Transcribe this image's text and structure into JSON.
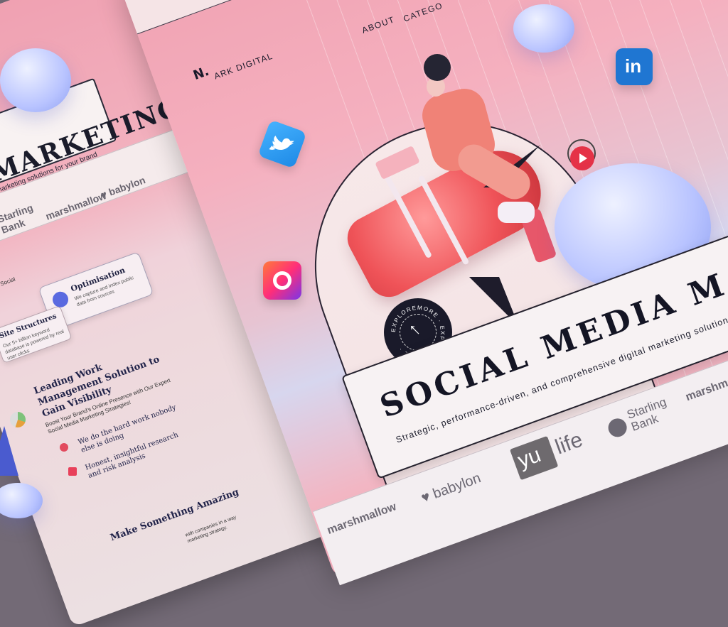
{
  "main": {
    "logo": {
      "mark": "N.",
      "text": "ARK DIGITAL"
    },
    "nav": {
      "about": "ABOUT",
      "categories": "CATEGO"
    },
    "headline": "SOCIAL MEDIA MARKETING",
    "subline": "Strategic, performance-driven, and comprehensive digital marketing solutions for your brand",
    "badge": {
      "text": "EXPLOREMORE · EXPLOREMORE ·"
    },
    "logos": {
      "marshmallow": "marshmallow",
      "babylon": "babylon",
      "yu": "yu",
      "life": "life",
      "starling": "Starling",
      "bank": "Bank",
      "marshmallow2": "marshmallow"
    }
  },
  "left": {
    "title": "MARKETING",
    "sub": "marketing solutions for your brand",
    "logos": {
      "babylon": "babylon",
      "marshmallow": "marshmallow",
      "starling": "Starling",
      "bank": "Bank"
    },
    "social": "Social",
    "cards": {
      "optimisation": {
        "title": "Optimisation",
        "desc": "We capture and index public data from sources"
      },
      "site": {
        "title": "Site Structures",
        "desc": "Our 5+ billion keyword database is powered by real user clicks"
      }
    },
    "heading2": "Leading Work Management Solution to Gain Visibility",
    "body2": "Boost Your Brand's Online Presence with Our Expert Social Media Marketing Strategies!",
    "bullet1": "We do the hard work nobody else is doing",
    "bullet2": "Honest, insightful research and risk analysis",
    "heading3": "Make Something Amazing",
    "body3": "with companies in a way marketing strategy."
  }
}
